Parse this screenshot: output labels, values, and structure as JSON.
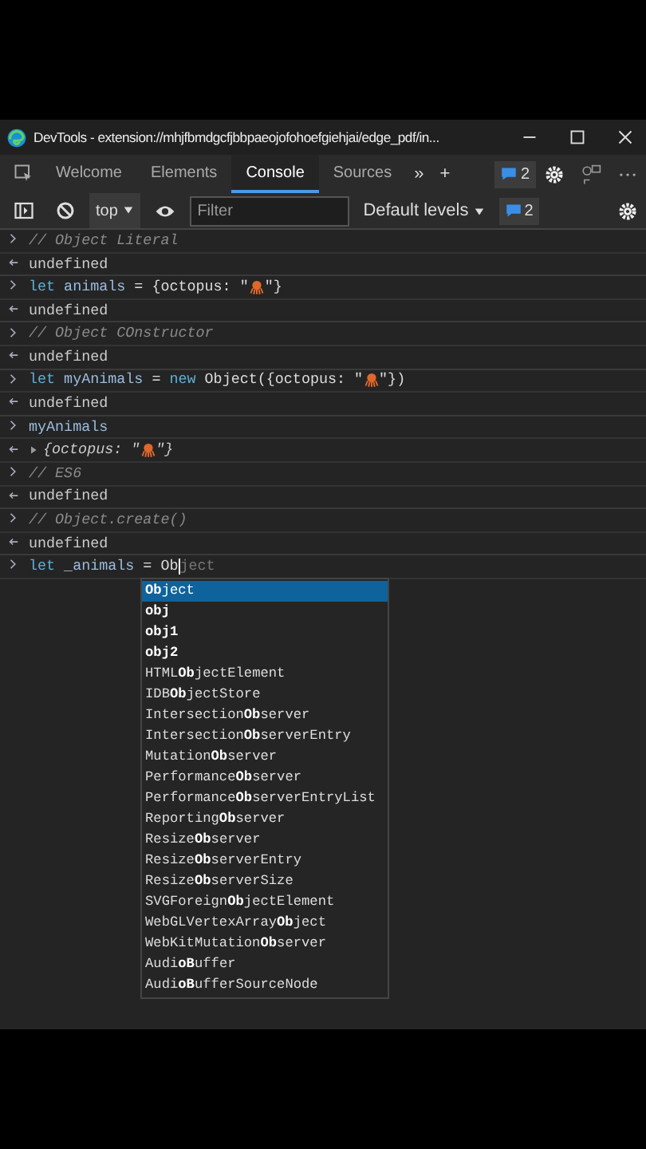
{
  "window": {
    "title": "DevTools - extension://mhjfbmdgcfjbbpaeojofohoefgiehjai/edge_pdf/in..."
  },
  "tabs": [
    {
      "label": "Welcome",
      "selected": false
    },
    {
      "label": "Elements",
      "selected": false
    },
    {
      "label": "Console",
      "selected": true
    },
    {
      "label": "Sources",
      "selected": false
    }
  ],
  "more_tabs": "»",
  "add_tab": "+",
  "issues_count": "2",
  "toolbar": {
    "context": "top",
    "filter": {
      "placeholder": "Filter"
    },
    "levels": "Default levels",
    "issues_count": "2"
  },
  "console": [
    {
      "kind": "input",
      "tokens": [
        {
          "kind": "comment",
          "text": "// Object Literal"
        }
      ]
    },
    {
      "kind": "output",
      "text": "undefined"
    },
    {
      "kind": "input",
      "tokens": [
        {
          "kind": "keyword",
          "text": "let"
        },
        {
          "kind": "variable",
          "text": " animals"
        },
        {
          "kind": "plain",
          "text": " = {octopus: \""
        },
        {
          "kind": "emoji"
        },
        {
          "kind": "plain",
          "text": "\"}"
        }
      ]
    },
    {
      "kind": "output",
      "text": "undefined"
    },
    {
      "kind": "input",
      "tokens": [
        {
          "kind": "comment",
          "text": "// Object COnstructor"
        }
      ]
    },
    {
      "kind": "output",
      "text": "undefined"
    },
    {
      "kind": "input",
      "tokens": [
        {
          "kind": "keyword",
          "text": "let"
        },
        {
          "kind": "variable",
          "text": " myAnimals"
        },
        {
          "kind": "plain",
          "text": " = "
        },
        {
          "kind": "keyword",
          "text": "new"
        },
        {
          "kind": "plain",
          "text": " Object({octopus: \""
        },
        {
          "kind": "emoji"
        },
        {
          "kind": "plain",
          "text": "\"})"
        }
      ]
    },
    {
      "kind": "output",
      "text": "undefined"
    },
    {
      "kind": "input",
      "tokens": [
        {
          "kind": "variable",
          "text": "myAnimals"
        }
      ]
    },
    {
      "kind": "object",
      "expanded": false,
      "tokens": [
        {
          "kind": "italic",
          "text": "{octopus: \""
        },
        {
          "kind": "emoji"
        },
        {
          "kind": "italic",
          "text": "\"}"
        }
      ]
    },
    {
      "kind": "input",
      "tokens": [
        {
          "kind": "comment",
          "text": "// ES6"
        }
      ]
    },
    {
      "kind": "output",
      "text": "undefined"
    },
    {
      "kind": "input",
      "tokens": [
        {
          "kind": "comment",
          "text": "// Object.create()"
        }
      ]
    },
    {
      "kind": "output",
      "text": "undefined"
    },
    {
      "kind": "prompt",
      "tokens": [
        {
          "kind": "keyword",
          "text": "let"
        },
        {
          "kind": "variable",
          "text": " _animals"
        },
        {
          "kind": "plain",
          "text": " = Ob"
        },
        {
          "kind": "caret"
        },
        {
          "kind": "ghost",
          "text": "ject"
        }
      ]
    }
  ],
  "autocomplete": [
    {
      "label": "**Ob**ject",
      "selected": true
    },
    {
      "label": "**obj**",
      "selected": false
    },
    {
      "label": "**obj1**",
      "selected": false
    },
    {
      "label": "**obj2**",
      "selected": false
    },
    {
      "label": "HTML**Ob**jectElement",
      "selected": false
    },
    {
      "label": "IDB**Ob**jectStore",
      "selected": false
    },
    {
      "label": "Intersection**Ob**server",
      "selected": false
    },
    {
      "label": "Intersection**Ob**serverEntry",
      "selected": false
    },
    {
      "label": "Mutation**Ob**server",
      "selected": false
    },
    {
      "label": "Performance**Ob**server",
      "selected": false
    },
    {
      "label": "Performance**Ob**serverEntryList",
      "selected": false
    },
    {
      "label": "Reporting**Ob**server",
      "selected": false
    },
    {
      "label": "Resize**Ob**server",
      "selected": false
    },
    {
      "label": "Resize**Ob**serverEntry",
      "selected": false
    },
    {
      "label": "Resize**Ob**serverSize",
      "selected": false
    },
    {
      "label": "SVGForeign**Ob**jectElement",
      "selected": false
    },
    {
      "label": "WebGLVertexArray**Ob**ject",
      "selected": false
    },
    {
      "label": "WebKitMutation**Ob**server",
      "selected": false
    },
    {
      "label": "Audi**oB**uffer",
      "selected": false
    },
    {
      "label": "Audi**oB**ufferSourceNode",
      "selected": false
    }
  ]
}
